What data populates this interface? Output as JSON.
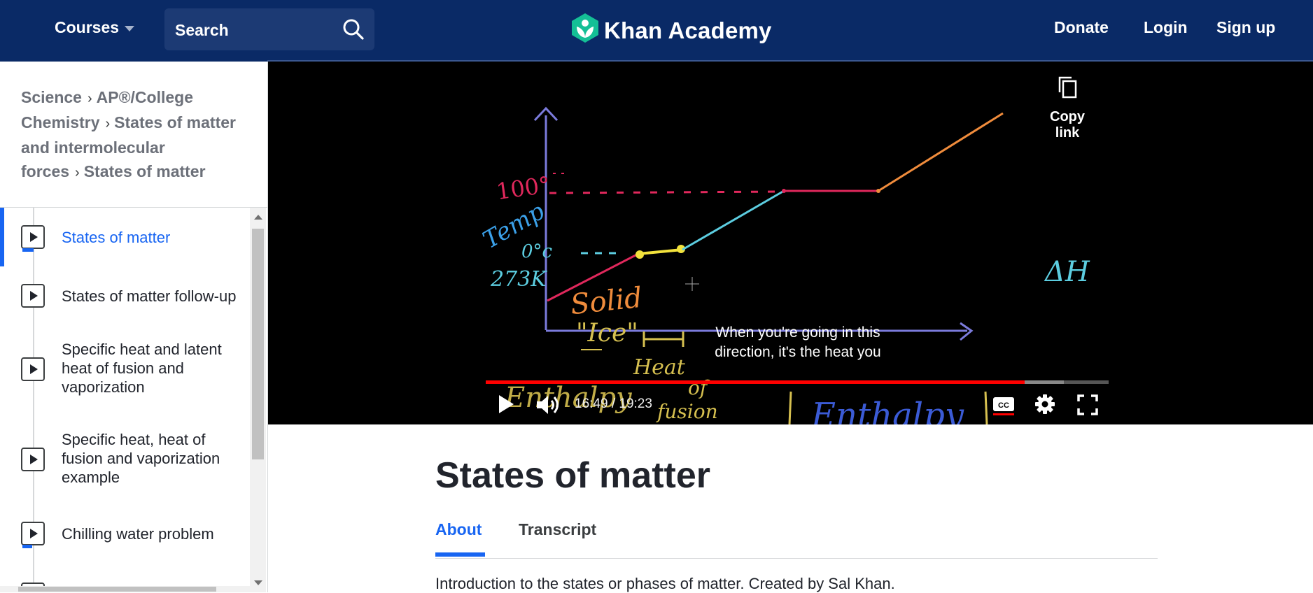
{
  "header": {
    "courses_label": "Courses",
    "search_placeholder": "Search",
    "logo_text": "Khan Academy",
    "donate_label": "Donate",
    "login_label": "Login",
    "signup_label": "Sign up"
  },
  "breadcrumb": {
    "items": [
      "Science",
      "AP®︎/College Chemistry",
      "States of matter and intermolecular forces",
      "States of matter"
    ],
    "separator": "›"
  },
  "sidebar": {
    "items": [
      {
        "label": "States of matter",
        "active": true
      },
      {
        "label": "States of matter follow-up",
        "active": false
      },
      {
        "label": "Specific heat and latent heat of fusion and vaporization",
        "active": false
      },
      {
        "label": "Specific heat, heat of fusion and vaporization example",
        "active": false
      },
      {
        "label": "Chilling water problem",
        "active": false
      }
    ]
  },
  "video": {
    "copy_link_label": "Copy link",
    "caption_line1": "When you're going in this",
    "caption_line2": "direction, it's the heat you",
    "time_display": "16:49 / 19:23",
    "progress_played": 0.865,
    "progress_loaded": 0.928,
    "board_labels": {
      "y_100": "100°",
      "temp": "Temp",
      "zero": "0°c",
      "kelvin": "273K",
      "solid": "Solid",
      "ice": "\"Ice\"",
      "heat": "Heat",
      "of": "of",
      "fusion": "fusion",
      "enthalpy_left": "Enthalpy",
      "enthalpy_right": "Enthalpy",
      "delta_h": "ΔH"
    }
  },
  "content": {
    "title": "States of matter",
    "tabs": [
      {
        "label": "About",
        "active": true
      },
      {
        "label": "Transcript",
        "active": false
      }
    ],
    "description": "Introduction to the states or phases of matter. Created by Sal Khan."
  },
  "colors": {
    "header_bg": "#0a2a66",
    "accent_blue": "#1865f2",
    "logo_green": "#14bf96",
    "progress_red": "#ff0000"
  }
}
